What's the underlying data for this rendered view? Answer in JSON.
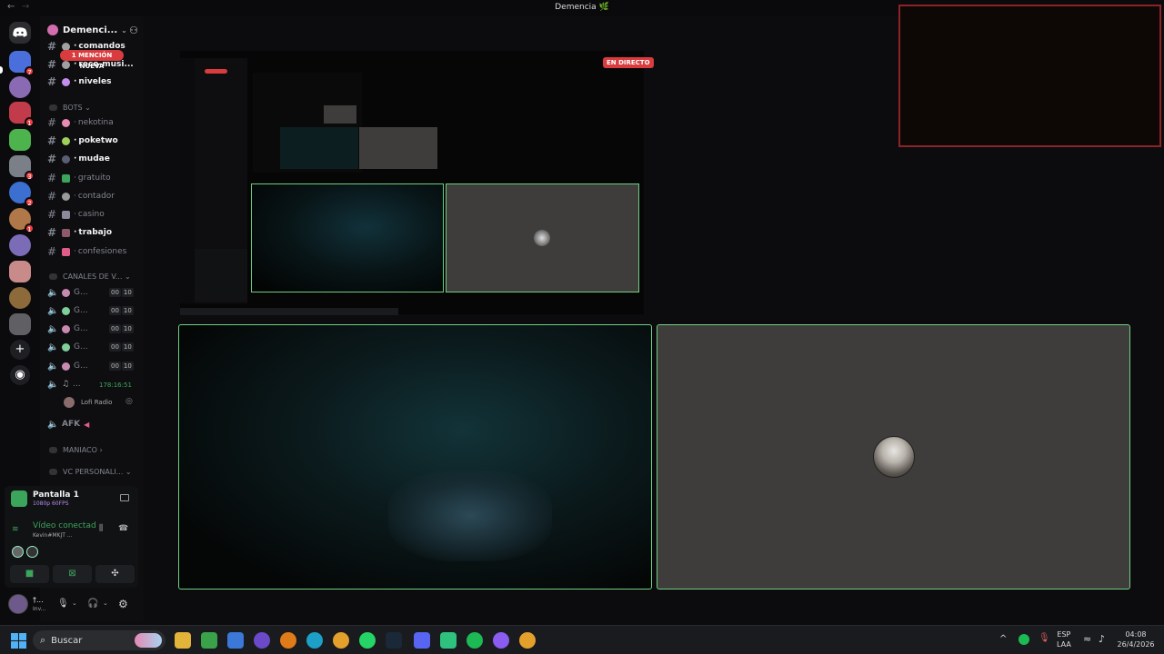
{
  "window": {
    "title": "Demencia 🌿",
    "back_glyph": "←",
    "forward_glyph": "→"
  },
  "guilds": [
    {
      "color": "#4a6fdc",
      "badge": "7"
    },
    {
      "color": "#8a6bb3",
      "badge": ""
    },
    {
      "color": "#c23b4b",
      "badge": "1"
    },
    {
      "color": "#4db34d",
      "badge": ""
    },
    {
      "color": "#7a7f88",
      "badge": "3"
    },
    {
      "color": "#3b6fd0",
      "badge": "2"
    },
    {
      "color": "#b07848",
      "badge": "1"
    },
    {
      "color": "#7c6bb6",
      "badge": ""
    },
    {
      "color": "#c98a8a",
      "badge": ""
    },
    {
      "color": "#8c6a3a",
      "badge": ""
    },
    {
      "color": "#5f5f64",
      "badge": ""
    }
  ],
  "server": {
    "name": "Demenci...",
    "mention_pill": "1 MENCIÓN NUEVA"
  },
  "channels_top": [
    {
      "name": "comandos",
      "unread": true,
      "color": "#a0a0a0"
    },
    {
      "name": "reco-musi...",
      "unread": true,
      "color": "#a0a0a0"
    },
    {
      "name": "niveles",
      "unread": true,
      "color": "#c58cf0"
    }
  ],
  "category_bots": "BOTS",
  "channels_bots": [
    {
      "name": "nekotina",
      "unread": false,
      "color": "#e88cb5"
    },
    {
      "name": "poketwo",
      "unread": true,
      "color": "#9ed05a"
    },
    {
      "name": "mudae",
      "unread": true,
      "color": "#5b5d75"
    },
    {
      "name": "gratuito",
      "unread": false,
      "color": "#3ba55c"
    },
    {
      "name": "contador",
      "unread": false,
      "color": "#9a9a9a"
    },
    {
      "name": "casino",
      "unread": false,
      "color": "#8a8a9a"
    },
    {
      "name": "trabajo",
      "unread": true,
      "color": "#8e5a6a"
    },
    {
      "name": "confesiones",
      "unread": false,
      "color": "#e05d8a"
    }
  ],
  "category_voice": "CANALES DE V...",
  "voice_channels": [
    {
      "name": "G...",
      "count_a": "00",
      "count_b": "10",
      "color": "#c98ab0"
    },
    {
      "name": "G...",
      "count_a": "00",
      "count_b": "10",
      "color": "#7fcf9a"
    },
    {
      "name": "G...",
      "count_a": "00",
      "count_b": "10",
      "color": "#c98ab0"
    },
    {
      "name": "G...",
      "count_a": "00",
      "count_b": "10",
      "color": "#7fcf9a"
    },
    {
      "name": "G...",
      "count_a": "00",
      "count_b": "10",
      "color": "#c98ab0"
    }
  ],
  "music_channel": {
    "name": "...",
    "timer": "178:16:51",
    "member": "Lofi Radio"
  },
  "afk_channel": "AFK",
  "category_maniaco": "MANIACO",
  "category_vc": "VC PERSONALI...",
  "voice_panel": {
    "stream_title": "Pantalla 1",
    "stream_quality": "1080p 60FPS",
    "status": "Vídeo conectad",
    "user": "Kevin#MKJT ..."
  },
  "userbar": {
    "name": "†...",
    "status": "Inv..."
  },
  "stage": {
    "live_label": "EN DIRECTO"
  },
  "taskbar": {
    "search_placeholder": "Buscar",
    "lang_top": "ESP",
    "lang_bottom": "LAA",
    "time": "04:08",
    "date": "26/4/2026"
  }
}
